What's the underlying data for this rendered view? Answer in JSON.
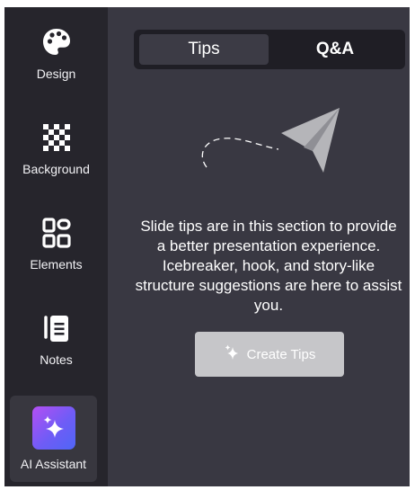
{
  "sidebar": {
    "items": [
      {
        "label": "Design",
        "icon": "palette-icon"
      },
      {
        "label": "Background",
        "icon": "checkerboard-icon"
      },
      {
        "label": "Elements",
        "icon": "shapes-icon"
      },
      {
        "label": "Notes",
        "icon": "notes-icon"
      },
      {
        "label": "AI Assistant",
        "icon": "sparkles-icon",
        "active": true
      }
    ]
  },
  "tabs": [
    {
      "label": "Tips",
      "active": true
    },
    {
      "label": "Q&A",
      "active": false
    }
  ],
  "main": {
    "illustration": "paper-plane-icon",
    "message": "Slide tips are in this section to provide a better presentation experience. Icebreaker, hook, and story-like structure suggestions are here to assist you.",
    "create_button": {
      "label": "Create Tips",
      "icon": "sparkle-icon"
    }
  },
  "colors": {
    "sidebar_bg": "#26252c",
    "panel_bg": "#393842",
    "accent_gradient": [
      "#b44ff3",
      "#4f66f6"
    ],
    "button_disabled": "#c6c6c9"
  }
}
